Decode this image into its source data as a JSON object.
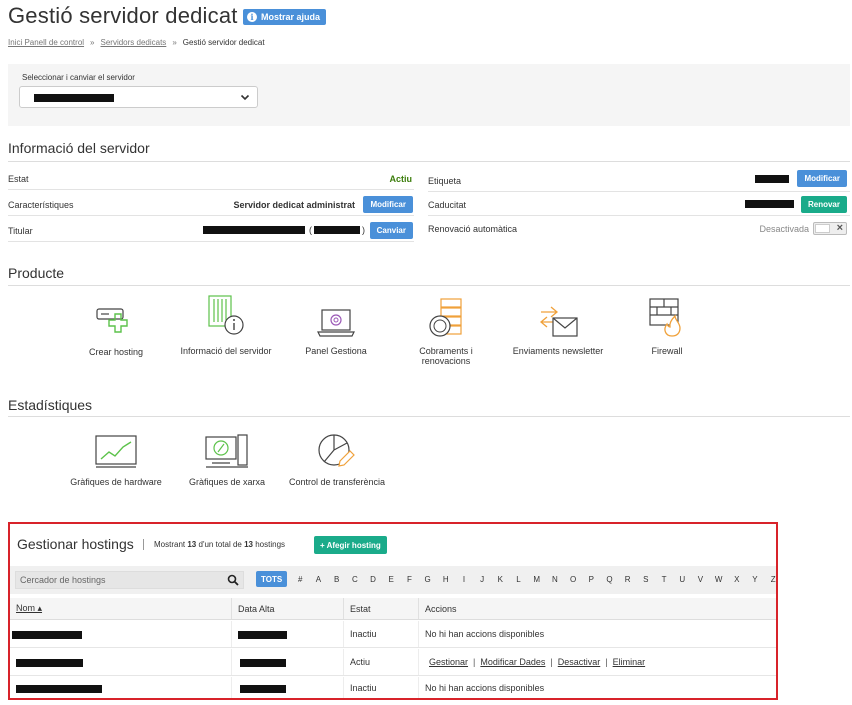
{
  "page": {
    "title": "Gestió servidor dedicat",
    "help_label": "Mostrar ajuda"
  },
  "breadcrumb": {
    "items": [
      "Inici Panell de control",
      "Servidors dedicats",
      "Gestió servidor dedicat"
    ],
    "separator": "»"
  },
  "server_select": {
    "label": "Seleccionar i canviar el servidor"
  },
  "info": {
    "title": "Informació del servidor",
    "estat_label": "Estat",
    "estat_value": "Actiu",
    "caracteristiques_label": "Característiques",
    "caracteristiques_value": "Servidor dedicat administrat",
    "titular_label": "Titular",
    "etiqueta_label": "Etiqueta",
    "caducitat_label": "Caducitat",
    "renovacio_label": "Renovació automàtica",
    "renovacio_value": "Desactivada",
    "modify_label": "Modificar",
    "change_label": "Canviar",
    "renew_label": "Renovar",
    "titular_paren_open": "(",
    "titular_paren_close": ")"
  },
  "producte": {
    "title": "Producte",
    "tiles": [
      {
        "label": "Crear hosting",
        "icon": "server-plus-icon"
      },
      {
        "label": "Informació del servidor",
        "icon": "server-info-icon"
      },
      {
        "label": "Panel Gestiona",
        "icon": "laptop-icon"
      },
      {
        "label": "Cobraments i renovacions",
        "icon": "coins-icon"
      },
      {
        "label": "Enviaments newsletter",
        "icon": "envelope-arrows-icon"
      },
      {
        "label": "Firewall",
        "icon": "firewall-icon"
      }
    ]
  },
  "estadistiques": {
    "title": "Estadístiques",
    "tiles": [
      {
        "label": "Gràfiques de hardware",
        "icon": "monitor-chart-icon"
      },
      {
        "label": "Gràfiques de xarxa",
        "icon": "network-chart-icon"
      },
      {
        "label": "Control de transferència",
        "icon": "pie-chart-icon"
      }
    ]
  },
  "hostings": {
    "title": "Gestionar hostings",
    "count_prefix": "Mostrant",
    "count_shown": "13",
    "count_mid": "d'un total de",
    "count_total": "13",
    "count_suffix": "hostings",
    "add_label": "+ Afegir hosting",
    "search_placeholder": "Cercador de hostings",
    "all_label": "TOTS",
    "letters": [
      "#",
      "A",
      "B",
      "C",
      "D",
      "E",
      "F",
      "G",
      "H",
      "I",
      "J",
      "K",
      "L",
      "M",
      "N",
      "O",
      "P",
      "Q",
      "R",
      "S",
      "T",
      "U",
      "V",
      "W",
      "X",
      "Y",
      "Z"
    ],
    "columns": {
      "name": "Nom ▴",
      "date": "Data Alta",
      "status": "Estat",
      "actions": "Accions"
    },
    "rows": [
      {
        "status": "Inactiu",
        "actions_text": "No hi han accions disponibles"
      },
      {
        "status": "Actiu",
        "actions": [
          "Gestionar",
          "Modificar Dades",
          "Desactivar",
          "Eliminar"
        ]
      },
      {
        "status": "Inactiu",
        "actions_text": "No hi han accions disponibles"
      }
    ]
  },
  "colors": {
    "accent_blue": "#4a90d9",
    "accent_green": "#1aab8a",
    "status_active": "#3b7d0b",
    "highlight_red": "#d8232a",
    "icon_green": "#5cc24a",
    "icon_orange": "#f0a13a"
  }
}
